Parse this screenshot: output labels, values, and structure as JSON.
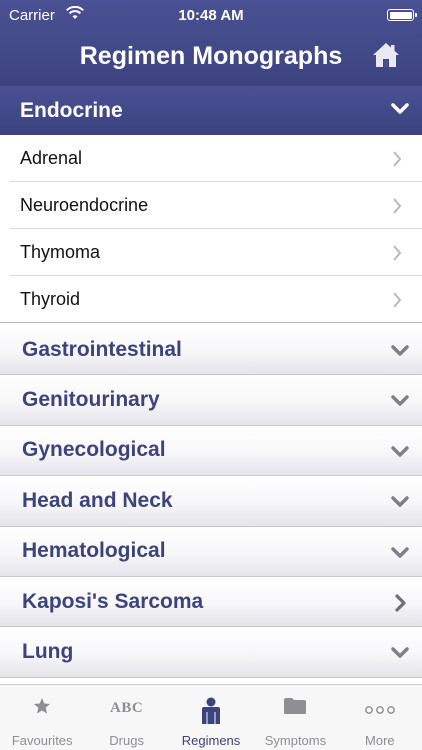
{
  "status_bar": {
    "carrier": "Carrier",
    "time": "10:48 AM"
  },
  "nav": {
    "title": "Regimen Monographs",
    "home_icon": "home-icon"
  },
  "section": {
    "label": "Endocrine",
    "expanded": true,
    "items": [
      {
        "label": "Adrenal"
      },
      {
        "label": "Neuroendocrine"
      },
      {
        "label": "Thymoma"
      },
      {
        "label": "Thyroid"
      }
    ]
  },
  "categories": [
    {
      "label": "Gastrointestinal",
      "indicator": "chevron-down"
    },
    {
      "label": "Genitourinary",
      "indicator": "chevron-down"
    },
    {
      "label": "Gynecological",
      "indicator": "chevron-down"
    },
    {
      "label": "Head and Neck",
      "indicator": "chevron-down"
    },
    {
      "label": "Hematological",
      "indicator": "chevron-down"
    },
    {
      "label": "Kaposi's Sarcoma",
      "indicator": "chevron-right"
    },
    {
      "label": "Lung",
      "indicator": "chevron-down"
    }
  ],
  "tabs": [
    {
      "label": "Favourites",
      "icon": "star-icon",
      "active": false
    },
    {
      "label": "Drugs",
      "icon": "abc-icon",
      "icon_text": "ABC",
      "active": false
    },
    {
      "label": "Regimens",
      "icon": "person-icon",
      "active": true
    },
    {
      "label": "Symptoms",
      "icon": "folder-icon",
      "active": false
    },
    {
      "label": "More",
      "icon": "more-icon",
      "active": false
    }
  ],
  "colors": {
    "bar": "#4a5194",
    "category_text": "#3c437d",
    "inactive_tab": "#8e8e93"
  }
}
